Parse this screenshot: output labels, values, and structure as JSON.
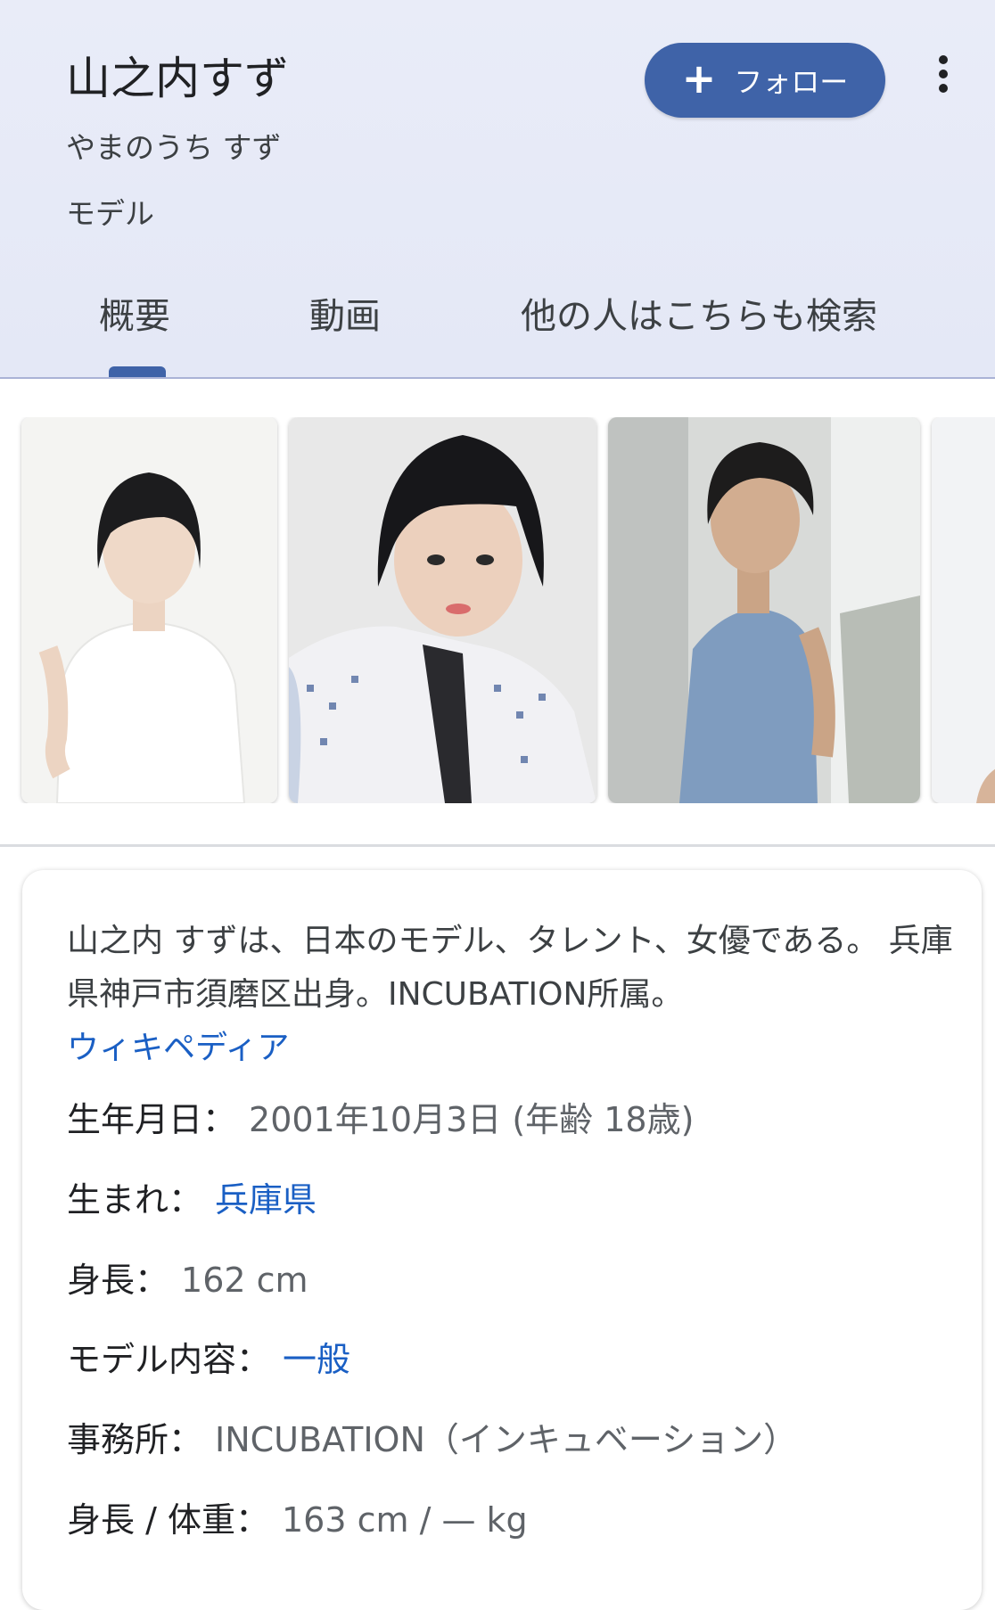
{
  "header": {
    "title": "山之内すず",
    "reading": "やまのうち すず",
    "occupation": "モデル",
    "follow_label": "フォロー"
  },
  "tabs": [
    {
      "label": "概要",
      "active": true
    },
    {
      "label": "動画",
      "active": false
    },
    {
      "label": "他の人はこちらも検索",
      "active": false
    }
  ],
  "description": {
    "text": "山之内 すずは、日本のモデル、タレント、女優である。 兵庫県神戸市須磨区出身。INCUBATION所属。",
    "source_link": "ウィキペディア"
  },
  "facts": [
    {
      "key": "生年月日：",
      "value": "2001年10月3日 (年齢 18歳)",
      "is_link": false
    },
    {
      "key": "生まれ：",
      "value": "兵庫県",
      "is_link": true
    },
    {
      "key": "身長：",
      "value": "162 cm",
      "is_link": false
    },
    {
      "key": "モデル内容：",
      "value": "一般",
      "is_link": true
    },
    {
      "key": "事務所：",
      "value": "INCUBATION（インキュベーション）",
      "is_link": false
    },
    {
      "key": "身長 / 体重：",
      "value": "163 cm / — kg",
      "is_link": false
    }
  ],
  "colors": {
    "accent": "#3f63a8",
    "link": "#1a5fc4",
    "header_bg": "#e9ecf8"
  }
}
